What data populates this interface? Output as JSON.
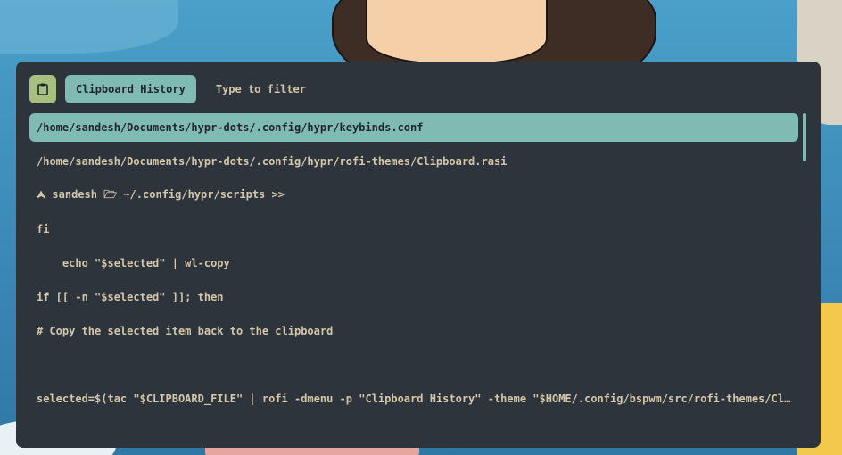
{
  "window": {
    "prompt_label": "Clipboard History",
    "filter_placeholder": "Type to filter",
    "filter_value": "",
    "icon": "clipboard-icon"
  },
  "colors": {
    "background": "#2e343b",
    "accent": "#7fbbb3",
    "icon_bg": "#a7c080",
    "text": "#d3c6aa"
  },
  "entries": [
    "/home/sandesh/Documents/hypr-dots/.config/hypr/keybinds.conf",
    "/home/sandesh/Documents/hypr-dots/.config/hypr/rofi-themes/Clipboard.rasi",
    "⮝ sandesh 🗁 ~/.config/hypr/scripts >>",
    "fi",
    "    echo \"$selected\" | wl-copy",
    "if [[ -n \"$selected\" ]]; then",
    "# Copy the selected item back to the clipboard",
    "",
    "selected=$(tac \"$CLIPBOARD_FILE\" | rofi -dmenu -p \"Clipboard History\" -theme \"$HOME/.config/bspwm/src/rofi-themes/Clipb…"
  ]
}
